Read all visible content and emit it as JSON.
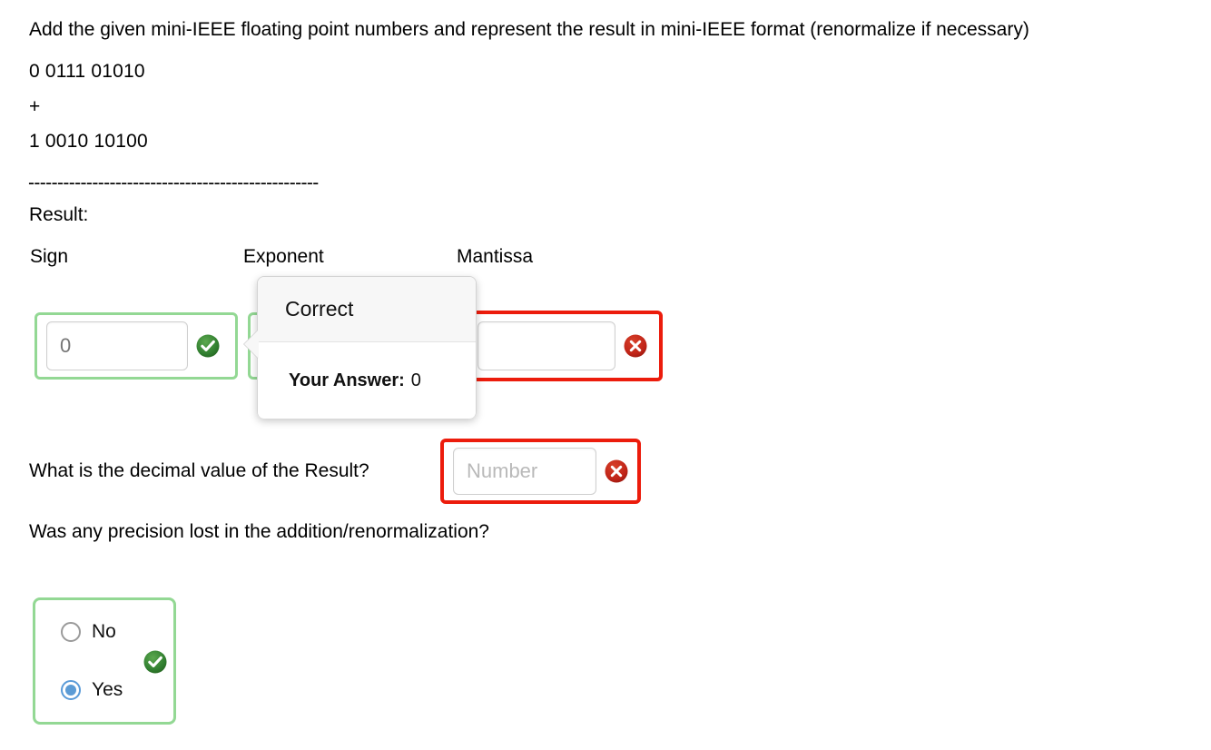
{
  "prompt": "Add the given mini-IEEE floating point numbers and represent the result in mini-IEEE format (renormalize if necessary)",
  "operands": {
    "first": "0 0111 01010",
    "plus": "+",
    "second": "1 0010 10100",
    "divider": "--------------------------------------------------"
  },
  "result": {
    "label": "Result:",
    "columns": {
      "sign": "Sign",
      "exponent": "Exponent",
      "mantissa": "Mantissa"
    },
    "fields": {
      "sign": {
        "value": "0",
        "placeholder": "",
        "status": "correct",
        "status_icon": "check-circle-icon"
      },
      "exponent": {
        "value": "",
        "placeholder": "",
        "status": "correct",
        "status_icon": "check-circle-icon"
      },
      "mantissa": {
        "value": "",
        "placeholder": "",
        "status": "incorrect",
        "status_icon": "x-circle-icon"
      }
    }
  },
  "decimal_question": {
    "label": "What is the decimal value of the Result?",
    "input": {
      "value": "",
      "placeholder": "Number",
      "status": "incorrect",
      "status_icon": "x-circle-icon"
    }
  },
  "precision_question": {
    "label": "Was any precision lost in the addition/renormalization?",
    "options": [
      {
        "label": "No",
        "selected": false
      },
      {
        "label": "Yes",
        "selected": true
      }
    ],
    "status": "correct",
    "status_icon": "check-circle-icon"
  },
  "feedback_popover": {
    "title": "Correct",
    "answer_label": "Your Answer:",
    "answer_value": "0"
  },
  "colors": {
    "correct_border": "#93d894",
    "incorrect_border": "#ec1c0c",
    "correct_badge": "#2e7d32",
    "incorrect_badge": "#c62828",
    "radio_selected": "#5b9bd5",
    "text": "#000000",
    "placeholder": "#b9b9b9",
    "popover_header_bg": "#f7f7f7"
  }
}
